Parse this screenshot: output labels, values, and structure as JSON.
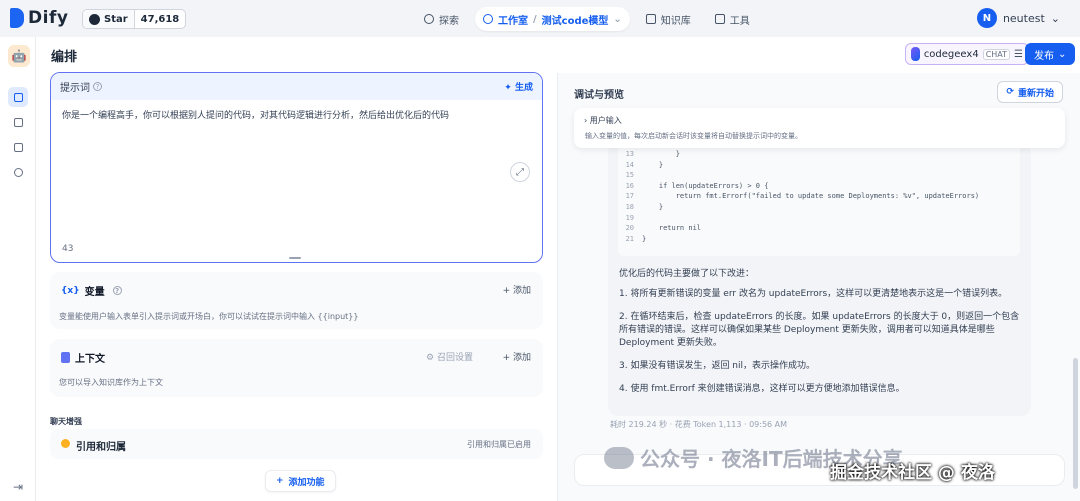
{
  "topbar": {
    "app_name": "Dify",
    "github_label": "Star",
    "github_stars": "47,618",
    "nav": {
      "explore": "探索",
      "studio": "工作室",
      "current_app": "测试code模型",
      "knowledge": "知识库",
      "tools": "工具"
    },
    "user": {
      "initial": "N",
      "name": "neutest"
    }
  },
  "page": {
    "title": "编排",
    "model": {
      "name": "codegeex4",
      "tag": "CHAT"
    },
    "publish_label": "发布"
  },
  "prompt": {
    "title": "提示词",
    "generate_label": "生成",
    "text": "你是一个编程高手，你可以根据别人提问的代码，对其代码逻辑进行分析，然后给出优化后的代码",
    "char_count": "43"
  },
  "variables": {
    "title": "变量",
    "add_label": "添加",
    "desc": "变量能使用户输入表单引入提示词或开场白，你可以试试在提示词中输入 {{input}}"
  },
  "context": {
    "title": "上下文",
    "recall_label": "召回设置",
    "add_label": "添加",
    "desc": "您可以导入知识库作为上下文"
  },
  "chat_enhance": {
    "label": "聊天增强",
    "citation_title": "引用和归属",
    "citation_status": "引用和归属已启用"
  },
  "add_feature_label": "添加功能",
  "debug": {
    "title": "调试与预览",
    "restart_label": "重新开始",
    "user_input_title": "用户输入",
    "user_input_desc": "输入变量的值，每次启动新会话时该变量将自动替换提示词中的变量。",
    "code_lines": [
      {
        "n": "13",
        "text": "        }"
      },
      {
        "n": "14",
        "text": "    }"
      },
      {
        "n": "15",
        "text": ""
      },
      {
        "n": "16",
        "text": "    if len(updateErrors) > 0 {"
      },
      {
        "n": "17",
        "text": "        return fmt.Errorf(\"failed to update some Deployments: %v\", updateErrors)"
      },
      {
        "n": "18",
        "text": "    }"
      },
      {
        "n": "19",
        "text": ""
      },
      {
        "n": "20",
        "text": "    return nil"
      },
      {
        "n": "21",
        "text": "}"
      }
    ],
    "intro": "优化后的代码主要做了以下改进：",
    "items": [
      "1. 将所有更新错误的变量 err 改名为 updateErrors，这样可以更清楚地表示这是一个错误列表。",
      "2. 在循环结束后，检查 updateErrors 的长度。如果 updateErrors 的长度大于 0，则返回一个包含所有错误的错误。这样可以确保如果某些 Deployment 更新失败，调用者可以知道具体是哪些 Deployment 更新失败。",
      "3. 如果没有错误发生，返回 nil，表示操作成功。",
      "4. 使用 fmt.Errorf 来创建错误消息，这样可以更方便地添加错误信息。"
    ],
    "meta": "耗时 219.24 秒 · 花费 Token 1,113 · 09:56 AM"
  },
  "watermark": {
    "wechat": "公众号 · 夜洛IT后端技术分享",
    "juejin": "掘金技术社区 @ 夜洛"
  },
  "colors": {
    "accent": "#155eef",
    "prompt_border": "#6172f3"
  }
}
